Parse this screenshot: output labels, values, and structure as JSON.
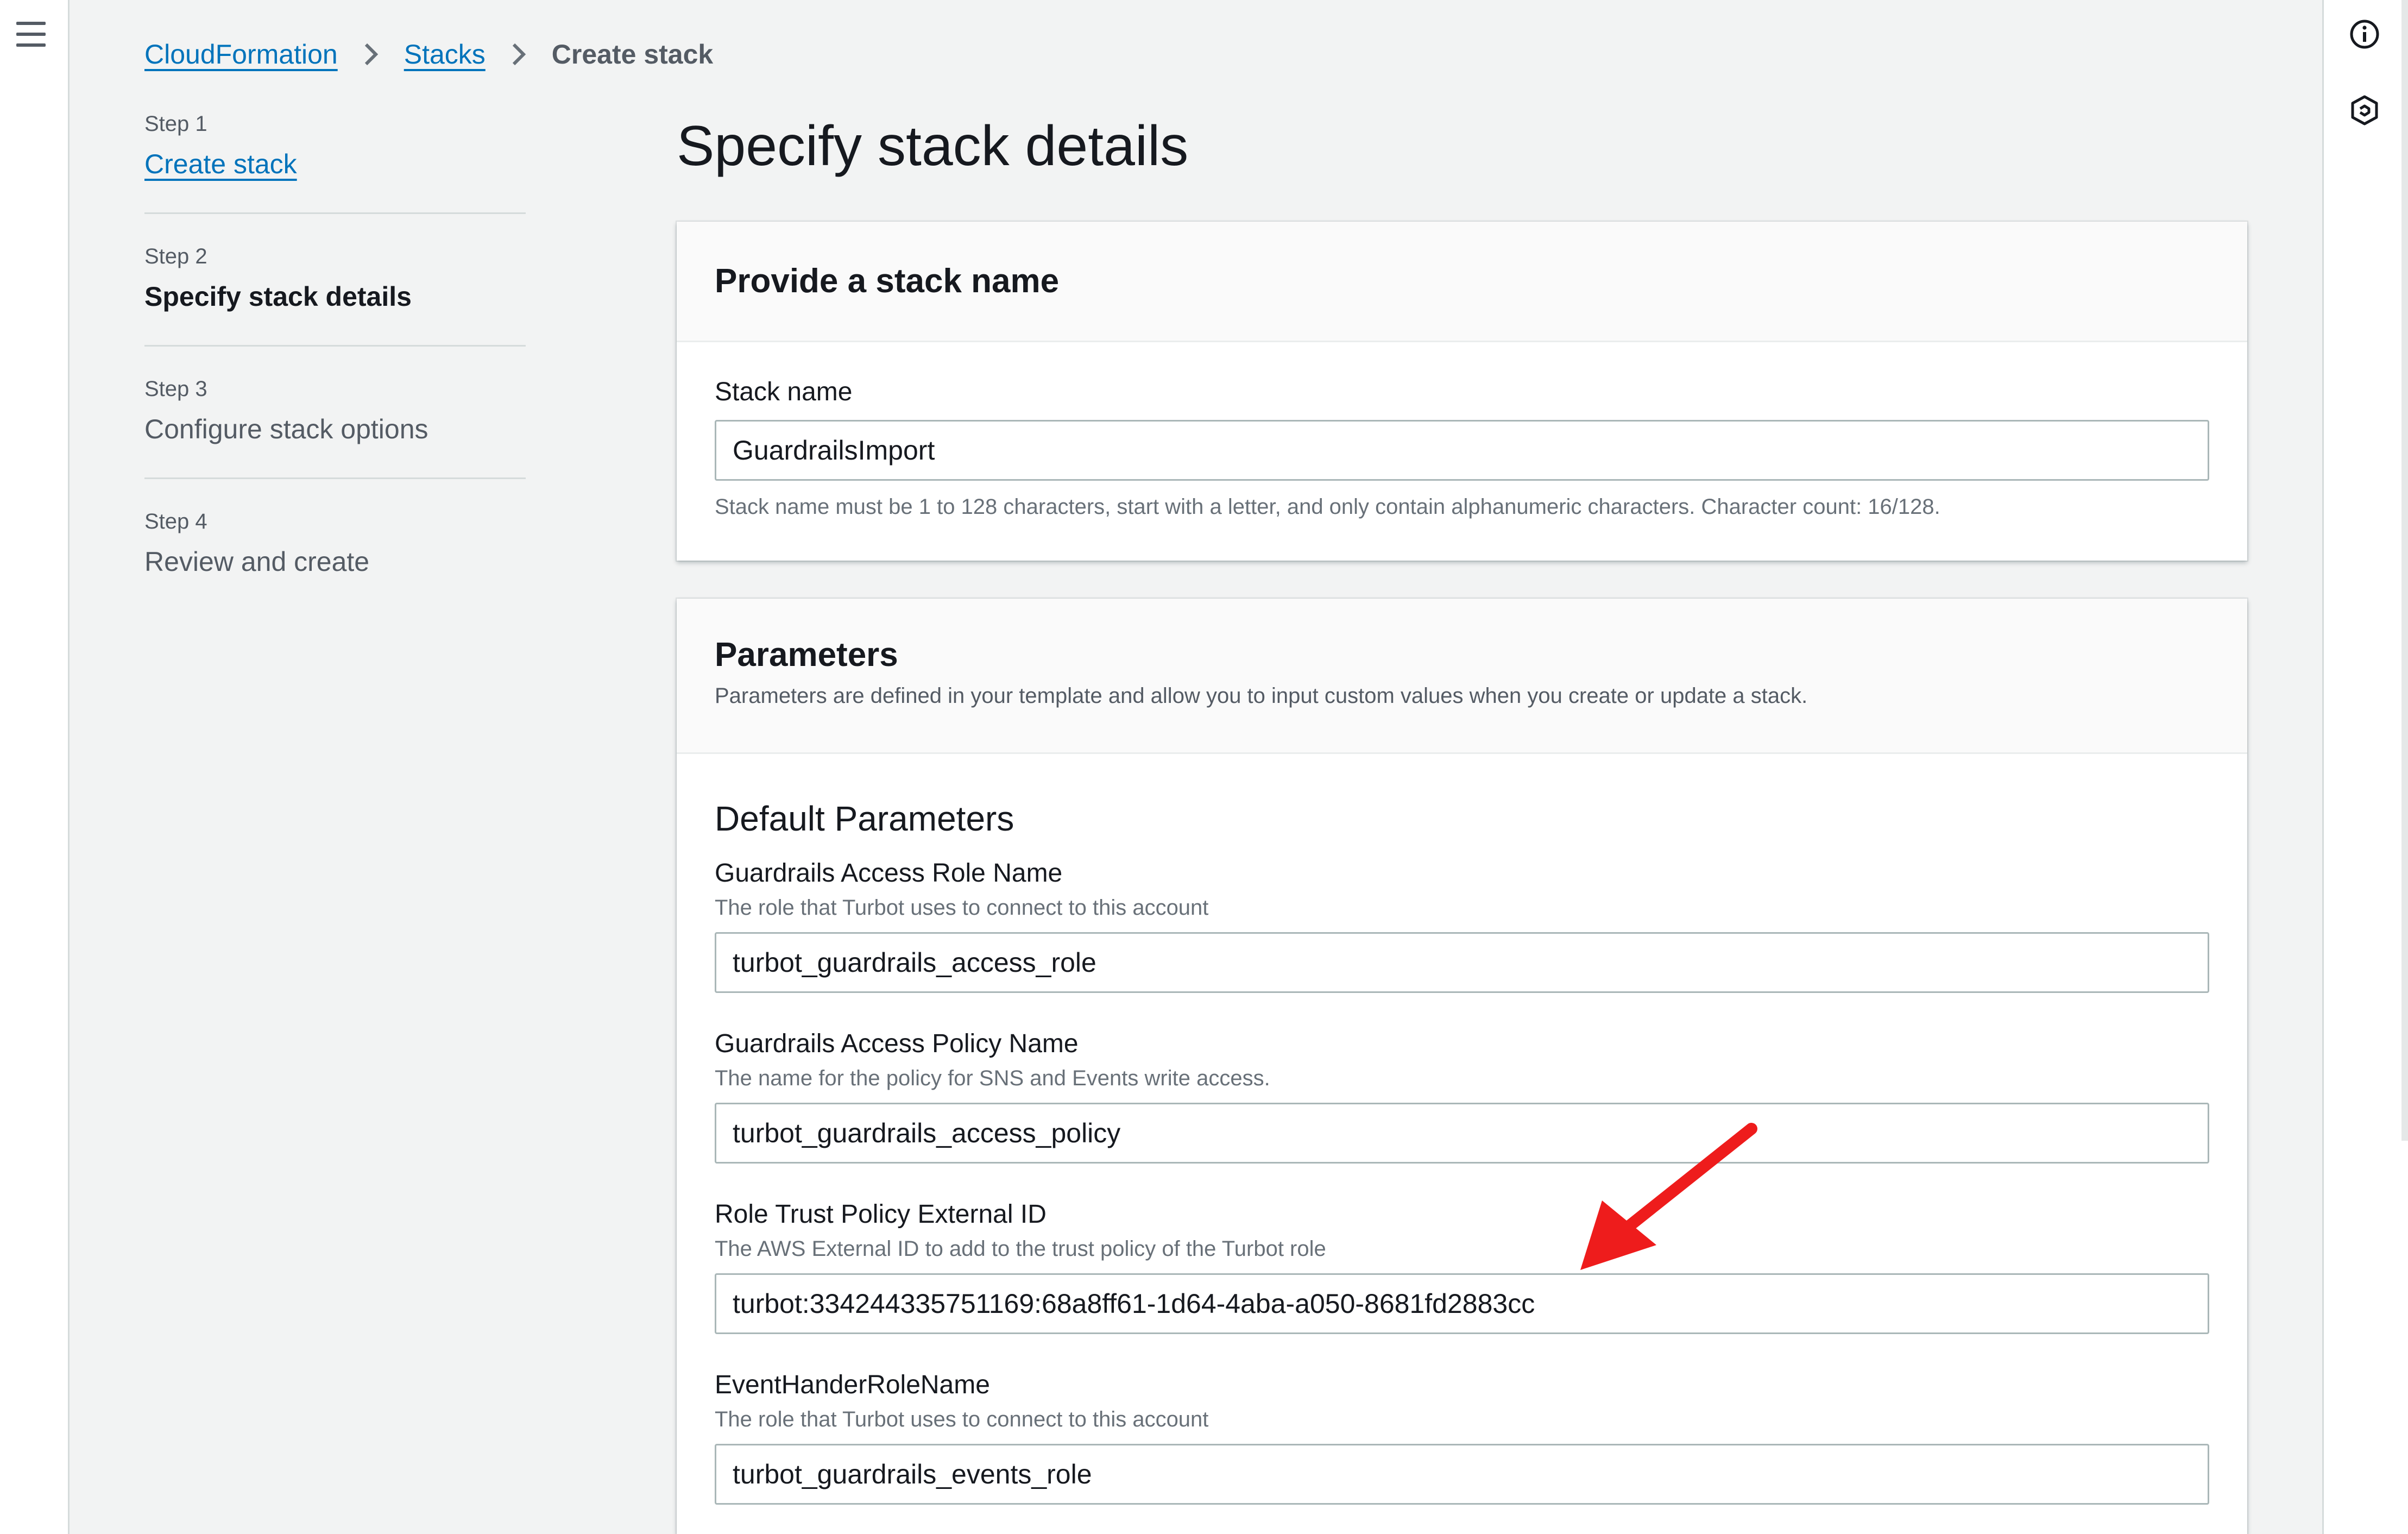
{
  "breadcrumb": {
    "items": [
      "CloudFormation",
      "Stacks"
    ],
    "current": "Create stack"
  },
  "steps": [
    {
      "number": "Step 1",
      "title": "Create stack",
      "state": "link"
    },
    {
      "number": "Step 2",
      "title": "Specify stack details",
      "state": "current"
    },
    {
      "number": "Step 3",
      "title": "Configure stack options",
      "state": "disabled"
    },
    {
      "number": "Step 4",
      "title": "Review and create",
      "state": "disabled"
    }
  ],
  "page": {
    "title": "Specify stack details"
  },
  "stack_name_card": {
    "title": "Provide a stack name",
    "field_label": "Stack name",
    "value": "GuardrailsImport",
    "constraint": "Stack name must be 1 to 128 characters, start with a letter, and only contain alphanumeric characters. Character count: 16/128."
  },
  "parameters_card": {
    "title": "Parameters",
    "description": "Parameters are defined in your template and allow you to input custom values when you create or update a stack.",
    "section_title": "Default Parameters",
    "fields": [
      {
        "label": "Guardrails Access Role Name",
        "description": "The role that Turbot uses to connect to this account",
        "value": "turbot_guardrails_access_role"
      },
      {
        "label": "Guardrails Access Policy Name",
        "description": "The name for the policy for SNS and Events write access.",
        "value": "turbot_guardrails_access_policy"
      },
      {
        "label": "Role Trust Policy External ID",
        "description": "The AWS External ID to add to the trust policy of the Turbot role",
        "value": "turbot:334244335751169:68a8ff61-1d64-4aba-a050-8681fd2883cc"
      },
      {
        "label": "EventHanderRoleName",
        "description": "The role that Turbot uses to connect to this account",
        "value": "turbot_guardrails_events_role"
      }
    ]
  },
  "icons": {
    "menu": "hamburger-icon",
    "info": "info-icon",
    "tools": "hexagon-icon",
    "separator": "chevron-right-icon"
  },
  "colors": {
    "link": "#0073bb",
    "annotation_arrow": "#ee1c1c",
    "background": "#f2f3f3"
  }
}
